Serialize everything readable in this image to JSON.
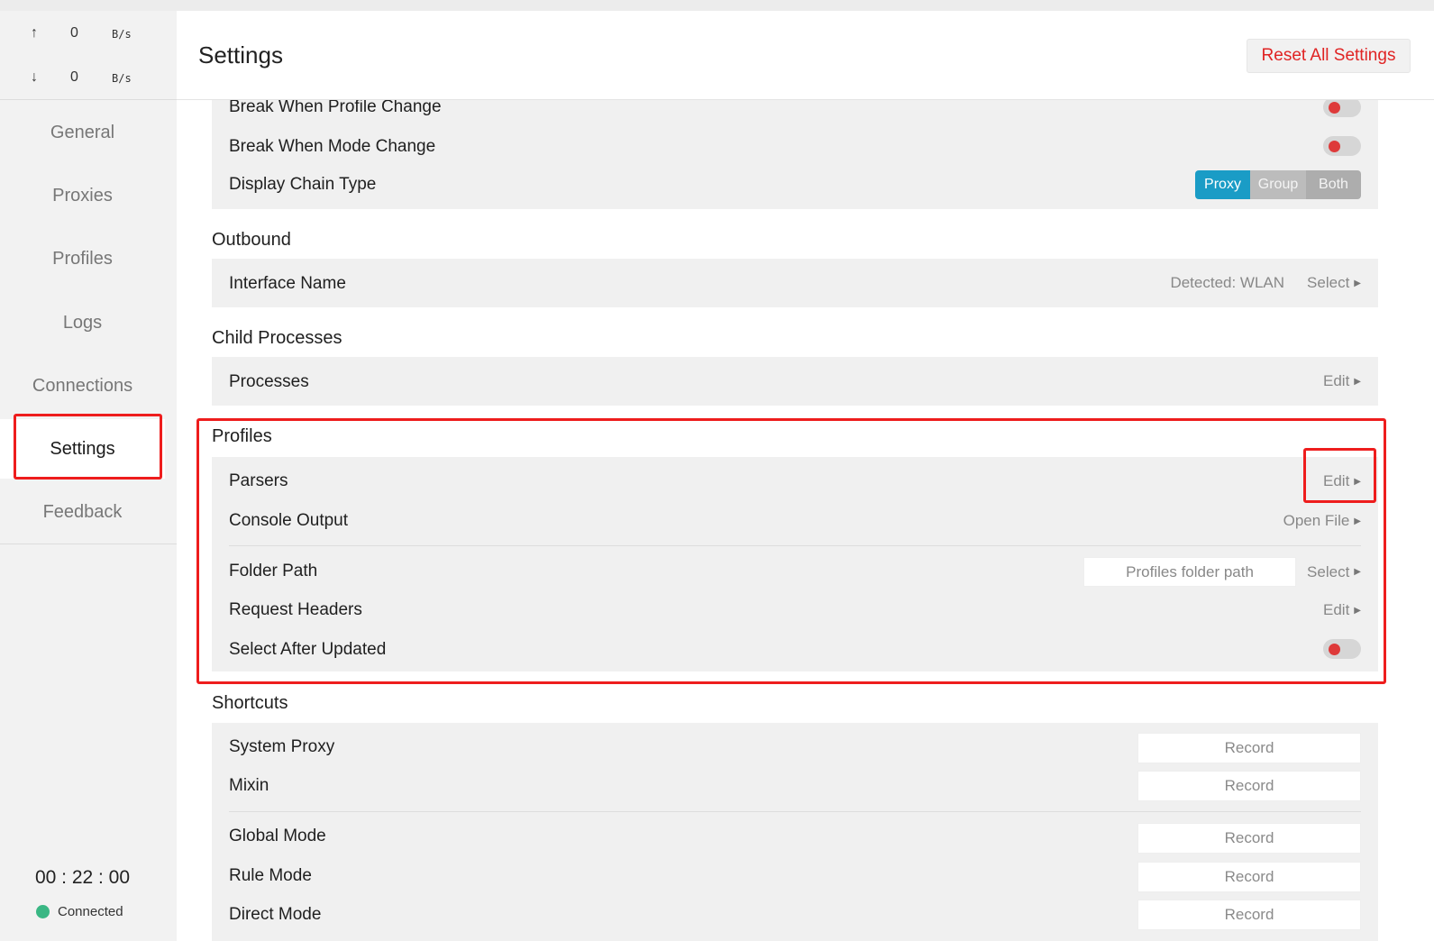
{
  "traffic": {
    "up": {
      "arrow": "↑",
      "value": "0",
      "unit": "B/s"
    },
    "down": {
      "arrow": "↓",
      "value": "0",
      "unit": "B/s"
    }
  },
  "nav": {
    "items": [
      {
        "label": "General"
      },
      {
        "label": "Proxies"
      },
      {
        "label": "Profiles"
      },
      {
        "label": "Logs"
      },
      {
        "label": "Connections"
      },
      {
        "label": "Settings"
      },
      {
        "label": "Feedback"
      }
    ],
    "active_index": 5
  },
  "status": {
    "timer": "00 : 22 : 00",
    "connection": "Connected",
    "connection_color": "#3ab784"
  },
  "header": {
    "title": "Settings",
    "reset_label": "Reset All Settings"
  },
  "top_group": {
    "break_profile_label": "Break When Profile Change",
    "break_mode_label": "Break When Mode Change",
    "chain_type_label": "Display Chain Type",
    "chain_options": [
      "Proxy",
      "Group",
      "Both"
    ],
    "chain_selected": "Proxy"
  },
  "outbound": {
    "title": "Outbound",
    "interface_label": "Interface Name",
    "detected": "Detected: WLAN",
    "select_label": "Select"
  },
  "child_processes": {
    "title": "Child Processes",
    "processes_label": "Processes",
    "edit_label": "Edit"
  },
  "profiles": {
    "title": "Profiles",
    "parsers_label": "Parsers",
    "parsers_action": "Edit",
    "console_label": "Console Output",
    "console_action": "Open File",
    "folder_label": "Folder Path",
    "folder_placeholder": "Profiles folder path",
    "folder_action": "Select",
    "headers_label": "Request Headers",
    "headers_action": "Edit",
    "select_after_label": "Select After Updated"
  },
  "shortcuts": {
    "title": "Shortcuts",
    "record_label": "Record",
    "items": [
      {
        "label": "System Proxy"
      },
      {
        "label": "Mixin"
      },
      {
        "label": "Global Mode"
      },
      {
        "label": "Rule Mode"
      },
      {
        "label": "Direct Mode"
      }
    ]
  },
  "colors": {
    "accent": "#1a9cc6",
    "danger": "#e02424",
    "highlight": "#ee1d1d",
    "toggle_knob": "#de3a3a"
  }
}
